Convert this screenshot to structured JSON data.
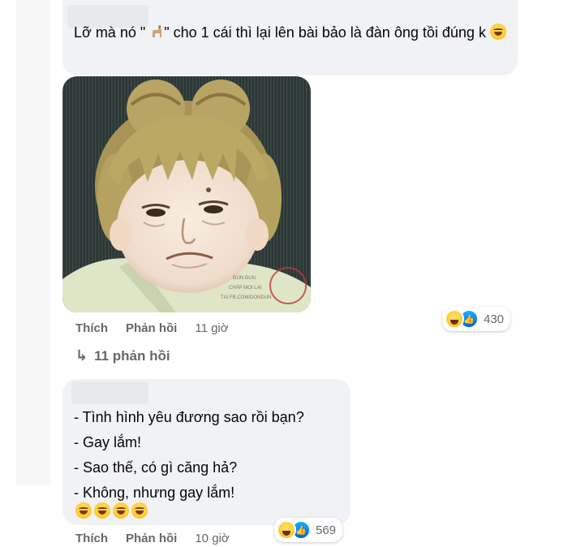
{
  "comments": [
    {
      "text_before": "Lỡ mà nó \" ",
      "text_after": "\" cho 1 cái thì lại lên bài bảo là đàn ông tồi đúng k",
      "reaction_count": "430",
      "actions": {
        "like": "Thích",
        "reply": "Phản hồi",
        "time": "11 giờ"
      },
      "replies_link": "11 phản hồi"
    },
    {
      "lines": [
        "- Tình hình yêu đương sao rồi bạn?",
        "- Gay lắm!",
        "- Sao thế, có gì căng hả?",
        "- Không, nhưng gay lắm!"
      ],
      "reaction_count": "569",
      "actions": {
        "like": "Thích",
        "reply": "Phản hồi",
        "time": "10 giờ"
      }
    }
  ],
  "image_watermark": [
    "ĐÔN ĐUN",
    "CHẤP MỌI LẠI",
    "TẠI FB.COM/DONDUN"
  ],
  "colors": {
    "bubble": "#f0f2f5",
    "muted_text": "#65676b",
    "like_blue": "#0866ff",
    "haha_yellow": "#ffcc33"
  },
  "icons": [
    "llama-emoji-icon",
    "laughing-emoji-icon",
    "haha-reaction-icon",
    "like-reaction-icon",
    "reply-arrow-icon"
  ]
}
